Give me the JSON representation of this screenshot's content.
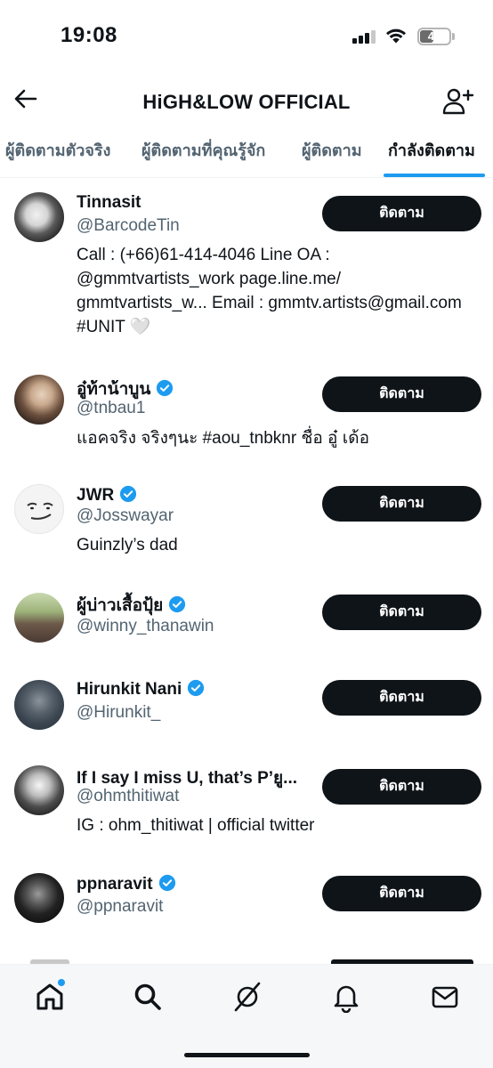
{
  "status_bar": {
    "time": "19:08",
    "battery": "44"
  },
  "header": {
    "title": "HiGH&LOW OFFICIAL",
    "back_icon": "arrow-left-icon",
    "add_icon": "person-plus-icon"
  },
  "tabs": [
    {
      "label": "ผู้ติดตามตัวจริง",
      "active": false
    },
    {
      "label": "ผู้ติดตามที่คุณรู้จัก",
      "active": false
    },
    {
      "label": "ผู้ติดตาม",
      "active": false
    },
    {
      "label": "กำลังติดตาม",
      "active": true
    }
  ],
  "follow_label": "ติดตาม",
  "users": [
    {
      "name": "Tinnasit",
      "handle": "@BarcodeTin",
      "verified": false,
      "bio": "Call : (+66)61-414-4046 Line OA : @gmmtvartists_work page.line.me/ gmmtvartists_w... Email : gmmtv.artists@gmail.com #UNIT 🤍"
    },
    {
      "name": "อู๋ท้าน้าบูน",
      "handle": "@tnbau1",
      "verified": true,
      "bio": "แอคจริง จริงๆนะ #aou_tnbknr ชื่อ อู๋ เด้อ"
    },
    {
      "name": "JWR",
      "handle": "@Josswayar",
      "verified": true,
      "bio": "Guinzly’s dad"
    },
    {
      "name": "ผู้บ่าวเสื้อปุ้ย",
      "handle": "@winny_thanawin",
      "verified": true,
      "bio": ""
    },
    {
      "name": "Hirunkit Nani",
      "handle": "@Hirunkit_",
      "verified": true,
      "bio": ""
    },
    {
      "name": "If I say I miss U, that’s P’ยู...",
      "handle": "@ohmthitiwat",
      "verified": false,
      "bio": "IG : ohm_thitiwat | official twitter"
    },
    {
      "name": "ppnaravit",
      "handle": "@ppnaravit",
      "verified": true,
      "bio": ""
    }
  ],
  "colors": {
    "accent": "#1d9bf0",
    "text": "#0f1419",
    "secondary": "#536471",
    "button": "#0f1419"
  },
  "bottom_nav": [
    {
      "name": "home-icon",
      "badge": true
    },
    {
      "name": "search-icon",
      "badge": false
    },
    {
      "name": "grok-icon",
      "badge": false
    },
    {
      "name": "notifications-icon",
      "badge": false
    },
    {
      "name": "messages-icon",
      "badge": false
    }
  ]
}
